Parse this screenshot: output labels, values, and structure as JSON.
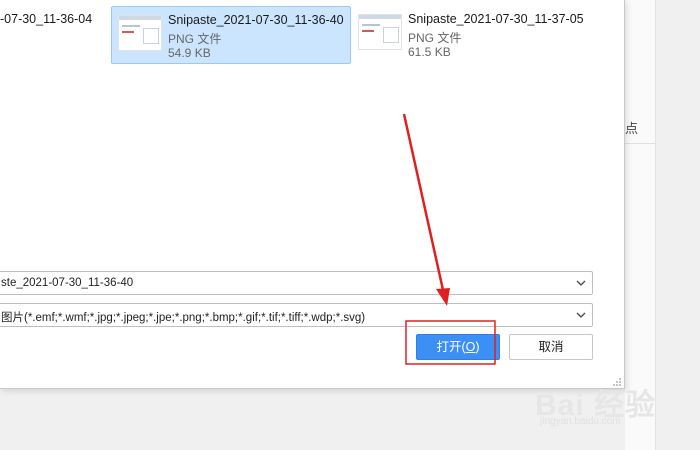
{
  "files": [
    {
      "name": "-07-30_11-36-04",
      "type": "",
      "size": ""
    },
    {
      "name": "Snipaste_2021-07-30_11-36-40",
      "type": "PNG 文件",
      "size": "54.9 KB"
    },
    {
      "name": "Snipaste_2021-07-30_11-37-05",
      "type": "PNG 文件",
      "size": "61.5 KB"
    }
  ],
  "filename_value": "ste_2021-07-30_11-36-40",
  "filetype_value": "图片(*.emf;*.wmf;*.jpg;*.jpeg;*.jpe;*.png;*.bmp;*.gif;*.tif;*.tiff;*.wdp;*.svg)",
  "buttons": {
    "open_label": "打开(",
    "open_mnemonic": "O",
    "open_suffix": ")",
    "cancel_label": "取消"
  },
  "background": {
    "partial_text": "点"
  },
  "watermark": {
    "main": "Bai 经验",
    "url": "jingyan.baidu.com"
  },
  "colors": {
    "accent": "#3b8ff5",
    "selection": "#cce5ff",
    "annotation": "#e02020"
  }
}
